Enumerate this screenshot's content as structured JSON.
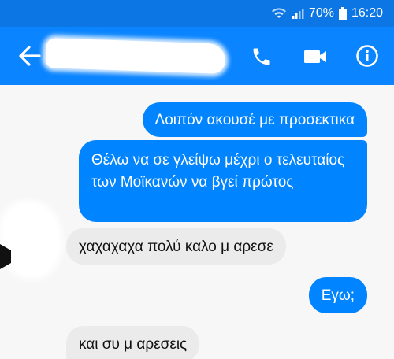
{
  "status_bar": {
    "battery": "70%",
    "time": "16:20",
    "icons": [
      "wifi-icon",
      "signal-icon",
      "battery-icon"
    ]
  },
  "header": {
    "contact_name": "",
    "icons": [
      "back-arrow-icon",
      "phone-icon",
      "video-camera-icon",
      "info-icon"
    ]
  },
  "messages": [
    {
      "direction": "outgoing",
      "text": "Λοιπόν ακουσέ με προσεκτικα"
    },
    {
      "direction": "outgoing",
      "text": "Θέλω να σε γλείψω μέχρι ο τελευταίος των Μοϊκανών να βγεί πρώτος"
    },
    {
      "direction": "incoming",
      "text": "χαχαχαχα πολύ καλο μ αρεσε"
    },
    {
      "direction": "outgoing",
      "text": "Εγω;"
    },
    {
      "direction": "incoming",
      "text": "και συ μ αρεσεις"
    }
  ],
  "colors": {
    "status_bar": "#0c77e4",
    "header": "#0a84ff",
    "outgoing_bubble": "#0084ff",
    "incoming_bubble": "#ebebeb",
    "background": "#f7f7f7"
  }
}
